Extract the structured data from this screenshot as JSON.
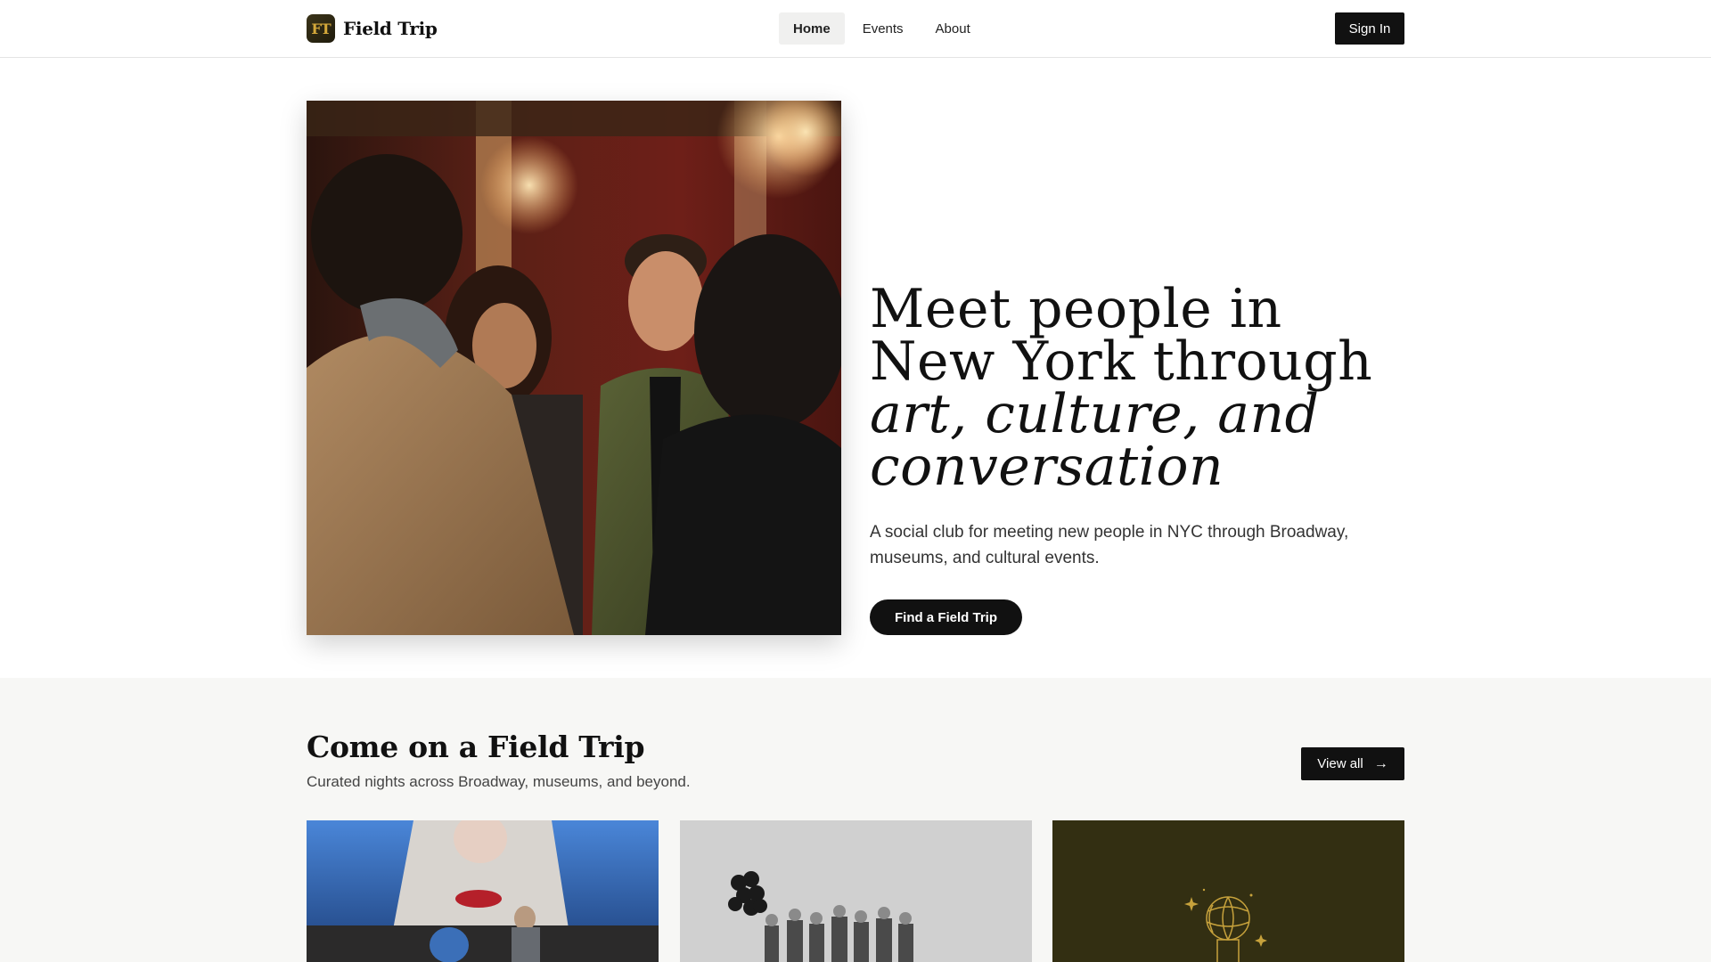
{
  "header": {
    "logo_mark": "FT",
    "brand_name": "Field Trip",
    "nav": [
      {
        "label": "Home",
        "active": true
      },
      {
        "label": "Events",
        "active": false
      },
      {
        "label": "About",
        "active": false
      }
    ],
    "signin_label": "Sign In"
  },
  "hero": {
    "title_line_plain": "Meet people in New York through ",
    "title_line_italic": "art, culture, and conversation",
    "subtitle": "A social club for meeting new people in NYC through Broadway, museums, and cultural events.",
    "cta_label": "Find a Field Trip",
    "image_icon": "photo-people-socializing"
  },
  "events_section": {
    "title": "Come on a Field Trip",
    "subtitle": "Curated nights across Broadway, museums, and beyond.",
    "view_all_label": "View all",
    "view_all_icon": "arrow-right-icon",
    "cards": [
      {
        "image_icon": "photo-theater-stage-blue-hair"
      },
      {
        "image_icon": "photo-group-with-balloons"
      },
      {
        "image_icon": "illustration-gold-globe-award"
      }
    ]
  },
  "colors": {
    "primary": "#111111",
    "section_bg": "#f7f7f5",
    "brand_gold": "#d4a83a",
    "nav_active_bg": "#f0f0ef"
  }
}
